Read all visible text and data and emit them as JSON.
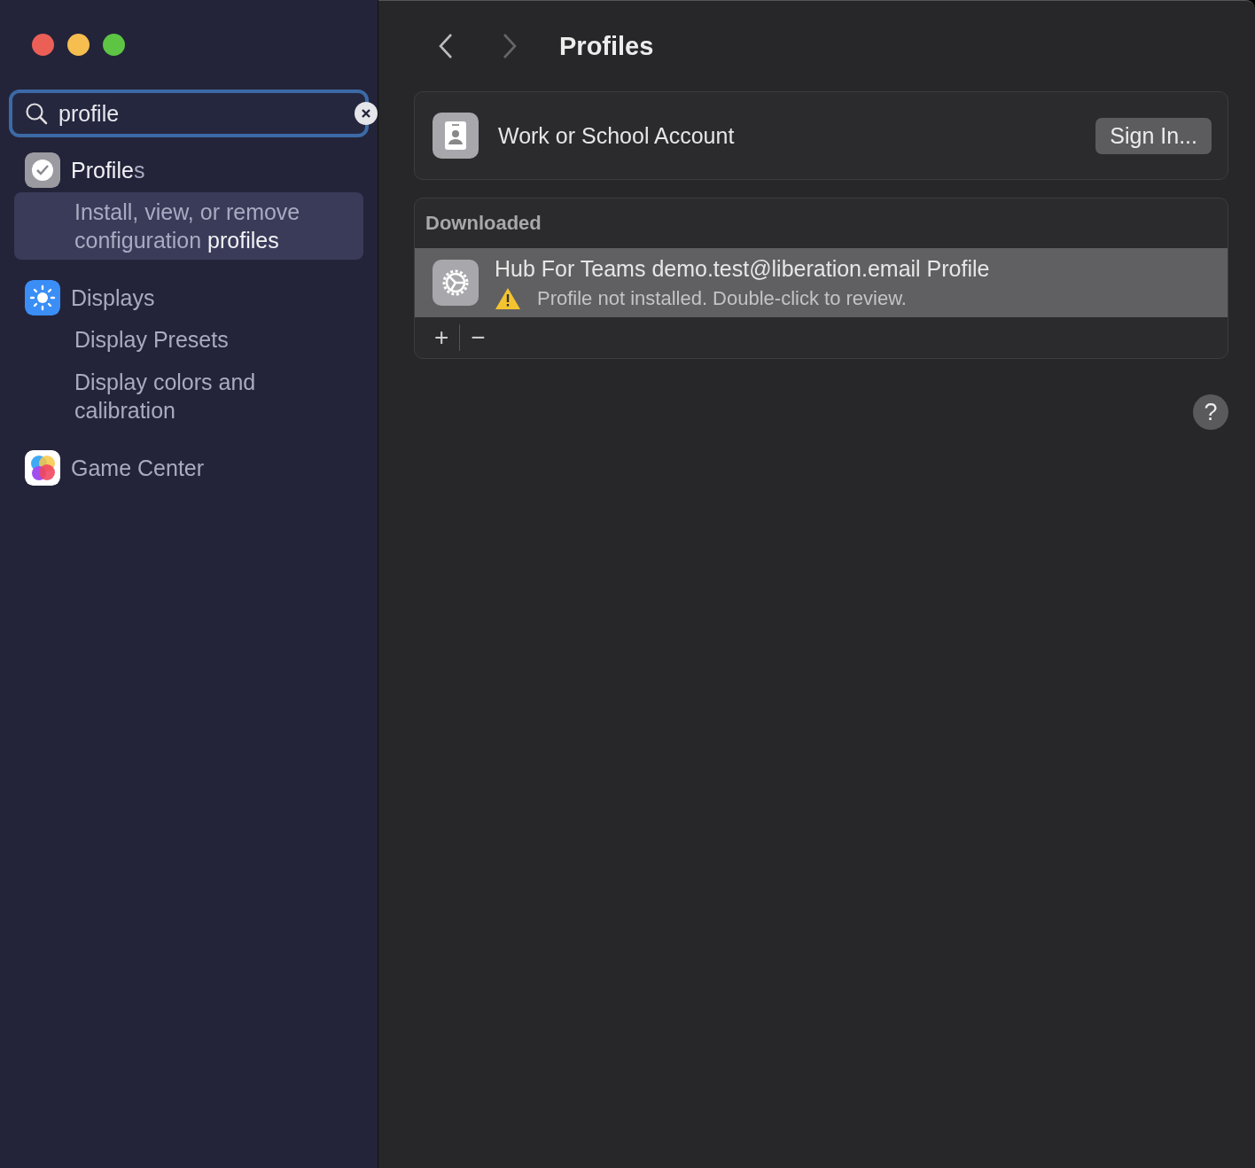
{
  "sidebar": {
    "search": {
      "value": "profile"
    },
    "results": [
      {
        "title": "**Profile**s",
        "kind": "profiles",
        "selected": false,
        "children": [
          {
            "text": "Install, view, or remove configuration **profiles**",
            "selected": true
          }
        ]
      },
      {
        "title": "Displays",
        "kind": "displays",
        "selected": false,
        "children": [
          {
            "text": "Display Presets",
            "selected": false
          },
          {
            "text": "Display colors and calibration",
            "selected": false
          }
        ]
      },
      {
        "title": "Game Center",
        "kind": "gamecenter",
        "selected": false
      }
    ]
  },
  "main": {
    "title": "Profiles",
    "account": {
      "label": "Work or School Account",
      "button": "Sign In..."
    },
    "downloaded": {
      "header": "Downloaded",
      "items": [
        {
          "name": "Hub For Teams demo.test@liberation.email Profile",
          "status": "Profile not installed. Double-click to review.",
          "warning": true,
          "selected": true
        }
      ],
      "add": "+",
      "remove": "−"
    },
    "help": "?"
  }
}
